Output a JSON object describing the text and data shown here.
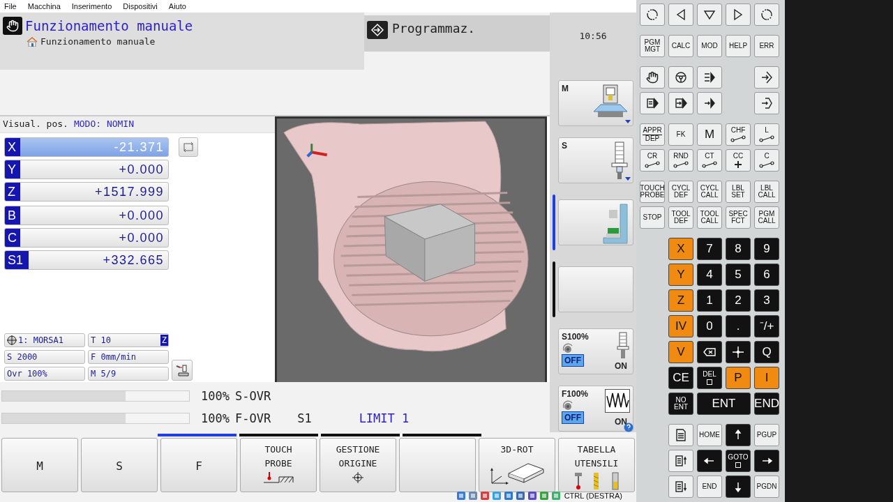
{
  "menu": [
    "File",
    "Macchina",
    "Inserimento",
    "Dispositivi",
    "Aiuto"
  ],
  "header": {
    "title": "Funzionamento manuale",
    "breadcrumb": "Funzionamento manuale",
    "mode_tab": "Programmaz.",
    "clock": "10:56"
  },
  "positions": {
    "caption": "Visual. pos.",
    "mode": "MODO: NOMIN",
    "linear": [
      {
        "axis": "X",
        "value": "-21.371",
        "selected": true
      },
      {
        "axis": "Y",
        "value": "+0.000",
        "selected": false
      },
      {
        "axis": "Z",
        "value": "+1517.999",
        "selected": false
      }
    ],
    "other": [
      {
        "axis": "B",
        "value": "+0.000",
        "selected": false
      },
      {
        "axis": "C",
        "value": "+0.000",
        "selected": false
      },
      {
        "axis": "S1",
        "value": "+332.665",
        "selected": false
      }
    ]
  },
  "status": {
    "fixture": "1: MORSA1",
    "tool": "T 10",
    "tool_axis": "Z",
    "spindle": "S 2000",
    "feed": "F 0mm/min",
    "override": "Ovr 100%",
    "mfunc": "M 5/9"
  },
  "overrides": [
    {
      "level": 0.66,
      "reading": "100%",
      "label": "S-OVR"
    },
    {
      "level": 0.66,
      "reading": "100%",
      "label": "F-OVR"
    }
  ],
  "spindle_label": "S1",
  "limit": "LIMIT 1",
  "side_cards": [
    {
      "label": "M",
      "kind": "machine"
    },
    {
      "label": "S",
      "kind": "spindle"
    },
    {
      "kind": "frame",
      "marker": {
        "selected": true
      }
    },
    {
      "kind": "blank",
      "marker": {
        "selected": false
      }
    }
  ],
  "side_overrides": [
    {
      "label": "S100%",
      "kind": "spindle",
      "options": [
        {
          "label": "OFF",
          "selected": true
        },
        {
          "label": "ON",
          "selected": false
        }
      ]
    },
    {
      "label": "F100%",
      "kind": "feed",
      "options": [
        {
          "label": "OFF",
          "selected": true
        },
        {
          "label": "ON",
          "selected": false
        }
      ]
    }
  ],
  "softkey_pages": [
    {
      "selected": true
    },
    {
      "selected": false
    },
    {
      "selected": false
    },
    {
      "selected": false
    }
  ],
  "softkeys": [
    {
      "label": "M",
      "kind": "text"
    },
    {
      "label": "S",
      "kind": "text"
    },
    {
      "label": "F",
      "kind": "text"
    },
    {
      "label": "TOUCH\nPROBE",
      "kind": "probe"
    },
    {
      "label": "GESTIONE\nORIGINE",
      "kind": "origin"
    },
    {
      "kind": "blank"
    },
    {
      "label": "3D-ROT",
      "kind": "rotate"
    },
    {
      "label": "TABELLA\nUTENSILI",
      "kind": "tools"
    }
  ],
  "tray_text": "CTRL (DESTRA)",
  "keypad": [
    {
      "kind": "full",
      "rows": [
        [
          {
            "kind": "rotate",
            "dark": false,
            "accent": false
          },
          {
            "kind": "tri-left",
            "dark": false,
            "accent": false
          },
          {
            "kind": "tri-down",
            "dark": false,
            "accent": false
          },
          {
            "kind": "tri-right",
            "dark": false,
            "accent": false
          },
          {
            "kind": "rotate",
            "dark": false,
            "accent": false
          }
        ]
      ]
    },
    {
      "kind": "full",
      "rows": [
        [
          {
            "label": "PGM\nMGT",
            "kind": "text",
            "dark": false,
            "accent": false
          },
          {
            "label": "CALC",
            "kind": "text",
            "dark": false,
            "accent": false
          },
          {
            "label": "MOD",
            "kind": "text",
            "dark": false,
            "accent": false
          },
          {
            "label": "HELP",
            "kind": "text",
            "dark": false,
            "accent": false
          },
          {
            "label": "ERR",
            "kind": "text",
            "dark": false,
            "accent": false
          }
        ]
      ]
    },
    {
      "kind": "split",
      "rows": [
        [
          {
            "kind": "hand",
            "dark": false,
            "accent": false
          },
          {
            "kind": "wheel",
            "dark": false,
            "accent": false
          },
          {
            "kind": "lines-arrow",
            "dark": false,
            "accent": false
          },
          {
            "kind": "diamond-arrow",
            "dark": false,
            "accent": false
          }
        ],
        [
          {
            "kind": "doc-arrow",
            "dark": false,
            "accent": false
          },
          {
            "kind": "box-arrow",
            "dark": false,
            "accent": false
          },
          {
            "kind": "bar-arrow",
            "dark": false,
            "accent": false
          },
          {
            "kind": "bracket-arrow",
            "dark": false,
            "accent": false
          }
        ]
      ]
    },
    {
      "kind": "full",
      "rows": [
        [
          {
            "label": "APPR\nDEP",
            "kind": "fraction",
            "dark": false,
            "accent": false
          },
          {
            "label": "FK",
            "kind": "text",
            "dark": false,
            "accent": false
          },
          {
            "label": "M",
            "kind": "big",
            "dark": false,
            "accent": false
          },
          {
            "label": "CHF",
            "kind": "path",
            "dark": false,
            "accent": false
          },
          {
            "label": "L",
            "kind": "path",
            "dark": false,
            "accent": false
          }
        ],
        [
          {
            "label": "CR",
            "kind": "path",
            "dark": false,
            "accent": false
          },
          {
            "label": "RND",
            "kind": "path",
            "dark": false,
            "accent": false
          },
          {
            "label": "CT",
            "kind": "path",
            "dark": false,
            "accent": false
          },
          {
            "label": "CC",
            "kind": "center",
            "dark": false,
            "accent": false
          },
          {
            "label": "C",
            "kind": "path",
            "dark": false,
            "accent": false
          }
        ]
      ]
    },
    {
      "kind": "full",
      "rows": [
        [
          {
            "label": "TOUCH\nPROBE",
            "kind": "text",
            "dark": false,
            "accent": false
          },
          {
            "label": "CYCL\nDEF",
            "kind": "text",
            "dark": false,
            "accent": false
          },
          {
            "label": "CYCL\nCALL",
            "kind": "text",
            "dark": false,
            "accent": false
          },
          {
            "label": "LBL\nSET",
            "kind": "text",
            "dark": false,
            "accent": false
          },
          {
            "label": "LBL\nCALL",
            "kind": "text",
            "dark": false,
            "accent": false
          }
        ],
        [
          {
            "label": "STOP",
            "kind": "text",
            "dark": false,
            "accent": false
          },
          {
            "label": "TOOL\nDEF",
            "kind": "text",
            "dark": false,
            "accent": false
          },
          {
            "label": "TOOL\nCALL",
            "kind": "text",
            "dark": false,
            "accent": false
          },
          {
            "label": "SPEC\nFCT",
            "kind": "text",
            "dark": false,
            "accent": false
          },
          {
            "label": "PGM\nCALL",
            "kind": "text",
            "dark": false,
            "accent": false
          }
        ]
      ]
    },
    {
      "kind": "right",
      "rows": [
        [
          {
            "label": "X",
            "kind": "big",
            "dark": false,
            "accent": true
          },
          {
            "label": "7",
            "kind": "big",
            "dark": true,
            "accent": false
          },
          {
            "label": "8",
            "kind": "big",
            "dark": true,
            "accent": false
          },
          {
            "label": "9",
            "kind": "big",
            "dark": true,
            "accent": false
          }
        ],
        [
          {
            "label": "Y",
            "kind": "big",
            "dark": false,
            "accent": true
          },
          {
            "label": "4",
            "kind": "big",
            "dark": true,
            "accent": false
          },
          {
            "label": "5",
            "kind": "big",
            "dark": true,
            "accent": false
          },
          {
            "label": "6",
            "kind": "big",
            "dark": true,
            "accent": false
          }
        ],
        [
          {
            "label": "Z",
            "kind": "big",
            "dark": false,
            "accent": true
          },
          {
            "label": "1",
            "kind": "big",
            "dark": true,
            "accent": false
          },
          {
            "label": "2",
            "kind": "big",
            "dark": true,
            "accent": false
          },
          {
            "label": "3",
            "kind": "big",
            "dark": true,
            "accent": false
          }
        ],
        [
          {
            "label": "IV",
            "kind": "big",
            "dark": false,
            "accent": true
          },
          {
            "label": "0",
            "kind": "big",
            "dark": true,
            "accent": false
          },
          {
            "label": ".",
            "kind": "big",
            "dark": true,
            "accent": false
          },
          {
            "label": "⁻/+",
            "kind": "big",
            "dark": true,
            "accent": false
          }
        ],
        [
          {
            "label": "V",
            "kind": "big",
            "dark": false,
            "accent": true
          },
          {
            "kind": "backspace",
            "dark": true,
            "accent": false
          },
          {
            "kind": "crosshair",
            "dark": true,
            "accent": false
          },
          {
            "label": "Q",
            "kind": "big",
            "dark": true,
            "accent": false
          }
        ],
        [
          {
            "label": "CE",
            "kind": "big",
            "dark": true,
            "accent": false
          },
          {
            "label": "DEL",
            "kind": "square",
            "dark": true,
            "accent": false
          },
          {
            "label": "P",
            "kind": "big",
            "dark": false,
            "accent": true
          },
          {
            "label": "I",
            "kind": "big",
            "dark": false,
            "accent": true
          }
        ]
      ]
    },
    {
      "kind": "joined",
      "rows": [
        [
          {
            "label": "NO\nENT",
            "kind": "text",
            "dark": true,
            "accent": false
          },
          {
            "label": "ENT",
            "kind": "wide",
            "dark": true,
            "accent": false
          },
          {
            "label": "END",
            "kind": "big",
            "dark": true,
            "accent": false
          }
        ]
      ]
    },
    {
      "kind": "right",
      "rows": [
        [
          {
            "kind": "doc",
            "dark": false,
            "accent": false
          },
          {
            "label": "HOME",
            "kind": "text",
            "dark": false,
            "accent": false
          },
          {
            "kind": "arrow-up",
            "dark": true,
            "accent": false
          },
          {
            "label": "PGUP",
            "kind": "text",
            "dark": false,
            "accent": false
          }
        ],
        [
          {
            "kind": "doc-up",
            "dark": false,
            "accent": false
          },
          {
            "kind": "arrow-left",
            "dark": true,
            "accent": false
          },
          {
            "label": "GOTO",
            "kind": "square",
            "dark": true,
            "accent": false
          },
          {
            "kind": "arrow-right",
            "dark": true,
            "accent": false
          }
        ],
        [
          {
            "kind": "doc-down",
            "dark": false,
            "accent": false
          },
          {
            "label": "END",
            "kind": "text",
            "dark": false,
            "accent": false
          },
          {
            "kind": "arrow-down",
            "dark": true,
            "accent": false
          },
          {
            "label": "PGDN",
            "kind": "text",
            "dark": false,
            "accent": false
          }
        ]
      ]
    }
  ]
}
